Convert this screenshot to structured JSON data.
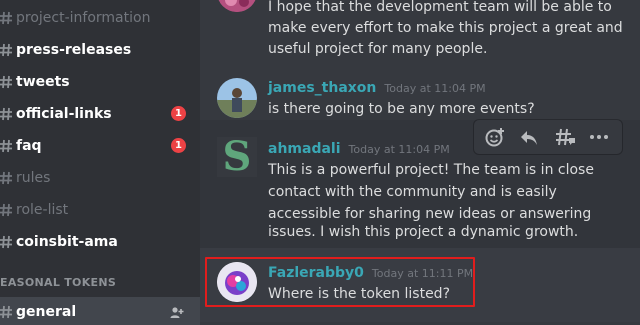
{
  "sidebar": {
    "channels": [
      {
        "label": "project-information",
        "state": "faded",
        "badge": null
      },
      {
        "label": "press-releases",
        "state": "bright",
        "badge": null
      },
      {
        "label": "tweets",
        "state": "bright",
        "badge": null
      },
      {
        "label": "official-links",
        "state": "bright",
        "badge": "1"
      },
      {
        "label": "faq",
        "state": "bright",
        "badge": "1"
      },
      {
        "label": "rules",
        "state": "faded",
        "badge": null
      },
      {
        "label": "role-list",
        "state": "faded",
        "badge": null
      },
      {
        "label": "coinsbit-ama",
        "state": "bright",
        "badge": null
      }
    ],
    "section_label": "EASONAL TOKENS",
    "active_channel": "general"
  },
  "messages": {
    "top_text": [
      "I hope that the development team will be able to",
      "make every effort to make this project a great and",
      "useful project for many people."
    ],
    "james": {
      "author": "james_thaxon",
      "timestamp": "Today at 11:04 PM",
      "text": "is there going to be any more events?"
    },
    "ahmadali": {
      "author": "ahmadali",
      "timestamp": "Today at 11:04 PM",
      "avatar_letter": "S",
      "lines": [
        "This is a powerful project! The team is in close",
        "contact with the community and is easily",
        "accessible for sharing new ideas or answering",
        "issues. I wish this project a dynamic growth."
      ]
    },
    "fazlerabby": {
      "author": "Fazlerabby0",
      "timestamp": "Today at 11:11 PM",
      "text": "Where is the token listed?"
    }
  },
  "toolbar": {
    "icons": [
      "add-reaction-icon",
      "reply-icon",
      "create-thread-icon",
      "more-icon"
    ]
  },
  "colors": {
    "accent_username": "#3aa7b5",
    "badge": "#ed4245",
    "highlight_border": "#e11d1d"
  }
}
